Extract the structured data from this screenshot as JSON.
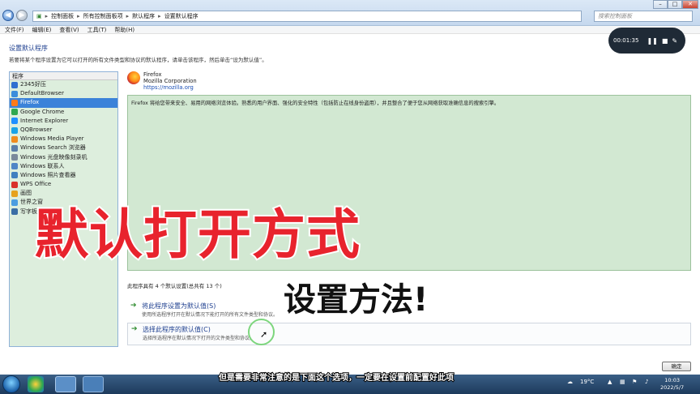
{
  "address": {
    "crumbs": [
      "控制面板",
      "所有控制面板项",
      "默认程序",
      "设置默认程序"
    ],
    "search_placeholder": "搜索控制面板"
  },
  "menu": [
    "文件(F)",
    "编辑(E)",
    "查看(V)",
    "工具(T)",
    "帮助(H)"
  ],
  "page": {
    "title": "设置默认程序",
    "description": "若要将某个程序设置为它可以打开的所有文件类型和协议的默认程序，请单击该程序，然后单击“设为默认值”。"
  },
  "program_list": {
    "header": "程序",
    "items": [
      {
        "label": "2345好压",
        "color": "#2f6fd0"
      },
      {
        "label": "DefaultBrowser",
        "color": "#3b8edb"
      },
      {
        "label": "Firefox",
        "color": "#ff7a1a"
      },
      {
        "label": "Google Chrome",
        "color": "#2fa84f"
      },
      {
        "label": "Internet Explorer",
        "color": "#1e90ff"
      },
      {
        "label": "QQBrowser",
        "color": "#19a3e6"
      },
      {
        "label": "Windows Media Player",
        "color": "#f08c1c"
      },
      {
        "label": "Windows Search 浏览器",
        "color": "#5a7fa8"
      },
      {
        "label": "Windows 光盘映像刻录机",
        "color": "#7a8a9a"
      },
      {
        "label": "Windows 联系人",
        "color": "#4f86c6"
      },
      {
        "label": "Windows 照片查看器",
        "color": "#3f7fbf"
      },
      {
        "label": "WPS Office",
        "color": "#d9312a"
      },
      {
        "label": "画图",
        "color": "#e6a21c"
      },
      {
        "label": "世界之窗",
        "color": "#4a9de0"
      },
      {
        "label": "写字板",
        "color": "#3a6ea5"
      }
    ],
    "selected_index": 2
  },
  "app": {
    "name": "Firefox",
    "publisher": "Mozilla Corporation",
    "url": "https://mozilla.org",
    "description": "Firefox 将给您带来安全、易用的网络浏览体验。熟悉的用户界面、强化的安全特性（包括防止在线身份盗用），并且整合了便于您从网络获取准确信息的搜索引擎。"
  },
  "defaults_count": "此程序具有 4 个默认设置(总共有 13 个)",
  "actions": [
    {
      "title": "将此程序设置为默认值(S)",
      "desc": "使用所选程序打开在默认情况下能打开的所有文件类型和协议。"
    },
    {
      "title": "选择此程序的默认值(C)",
      "desc": "选择所选程序在默认情况下打开的文件类型和协议。"
    }
  ],
  "ok_label": "确定",
  "recorder": {
    "time": "00:01:35"
  },
  "overlay": {
    "headline": "默认打开方式",
    "subheadline": "设置方法!",
    "subtitle": "但是需要非常注意的是下面这个选项，一定要在设置前配置好此项"
  },
  "taskbar": {
    "weather": "19°C",
    "time": "10:03",
    "date": "2022/5/7"
  }
}
